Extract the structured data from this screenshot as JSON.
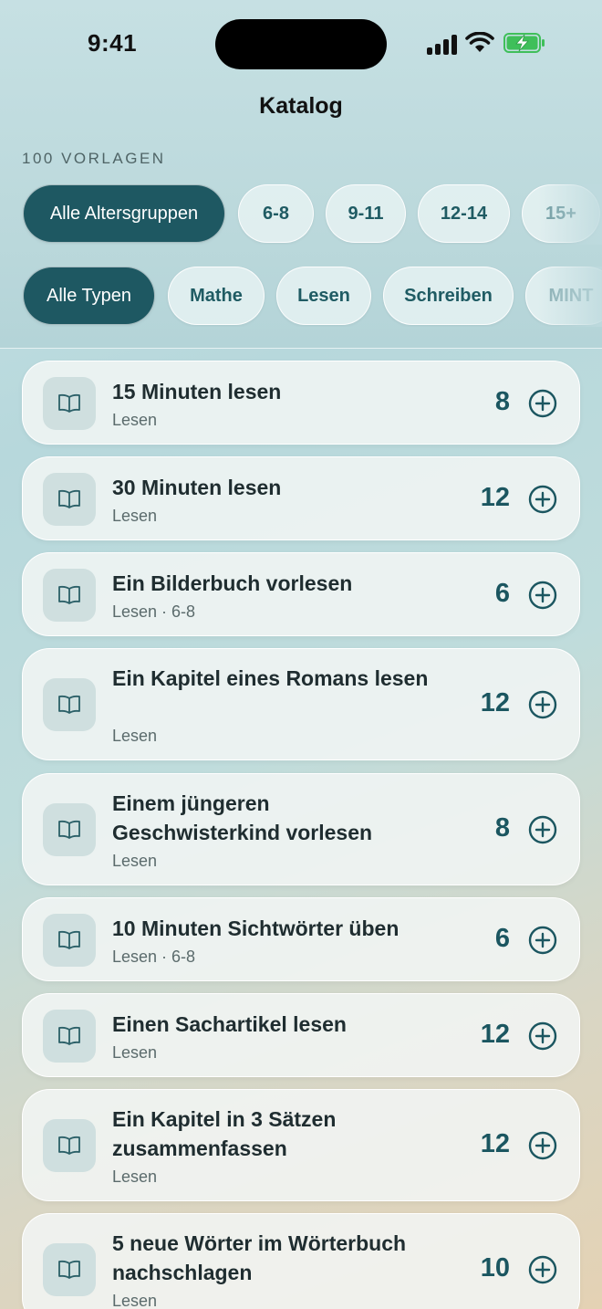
{
  "status_bar": {
    "time": "9:41"
  },
  "nav": {
    "title": "Katalog"
  },
  "count_label": "100 VORLAGEN",
  "age_filters": [
    "Alle Altersgruppen",
    "6-8",
    "9-11",
    "12-14",
    "15+"
  ],
  "type_filters": [
    "Alle Typen",
    "Mathe",
    "Lesen",
    "Schreiben",
    "MINT"
  ],
  "items": [
    {
      "title": "15 Minuten lesen",
      "subtitle": "Lesen",
      "points": "8",
      "icon": "book-icon"
    },
    {
      "title": "30 Minuten lesen",
      "subtitle": "Lesen",
      "points": "12",
      "icon": "book-icon"
    },
    {
      "title": "Ein Bilderbuch vorlesen",
      "subtitle": "Lesen · 6-8",
      "points": "6",
      "icon": "book-icon"
    },
    {
      "title": "Ein Kapitel eines Romans lesen",
      "subtitle": "Lesen",
      "points": "12",
      "icon": "book-icon"
    },
    {
      "title": "Einem jüngeren Geschwisterkind vorlesen",
      "subtitle": "Lesen",
      "points": "8",
      "icon": "book-icon"
    },
    {
      "title": "10 Minuten Sichtwörter üben",
      "subtitle": "Lesen · 6-8",
      "points": "6",
      "icon": "book-icon"
    },
    {
      "title": "Einen Sachartikel lesen",
      "subtitle": "Lesen",
      "points": "12",
      "icon": "book-icon"
    },
    {
      "title": "Ein Kapitel in 3 Sätzen zusammenfassen",
      "subtitle": "Lesen",
      "points": "12",
      "icon": "book-icon"
    },
    {
      "title": "5 neue Wörter im Wörterbuch nachschlagen",
      "subtitle": "Lesen",
      "points": "10",
      "icon": "book-icon"
    }
  ],
  "colors": {
    "accent": "#1e5862",
    "chip_text": "#1f5b63",
    "points": "#1b5660"
  }
}
